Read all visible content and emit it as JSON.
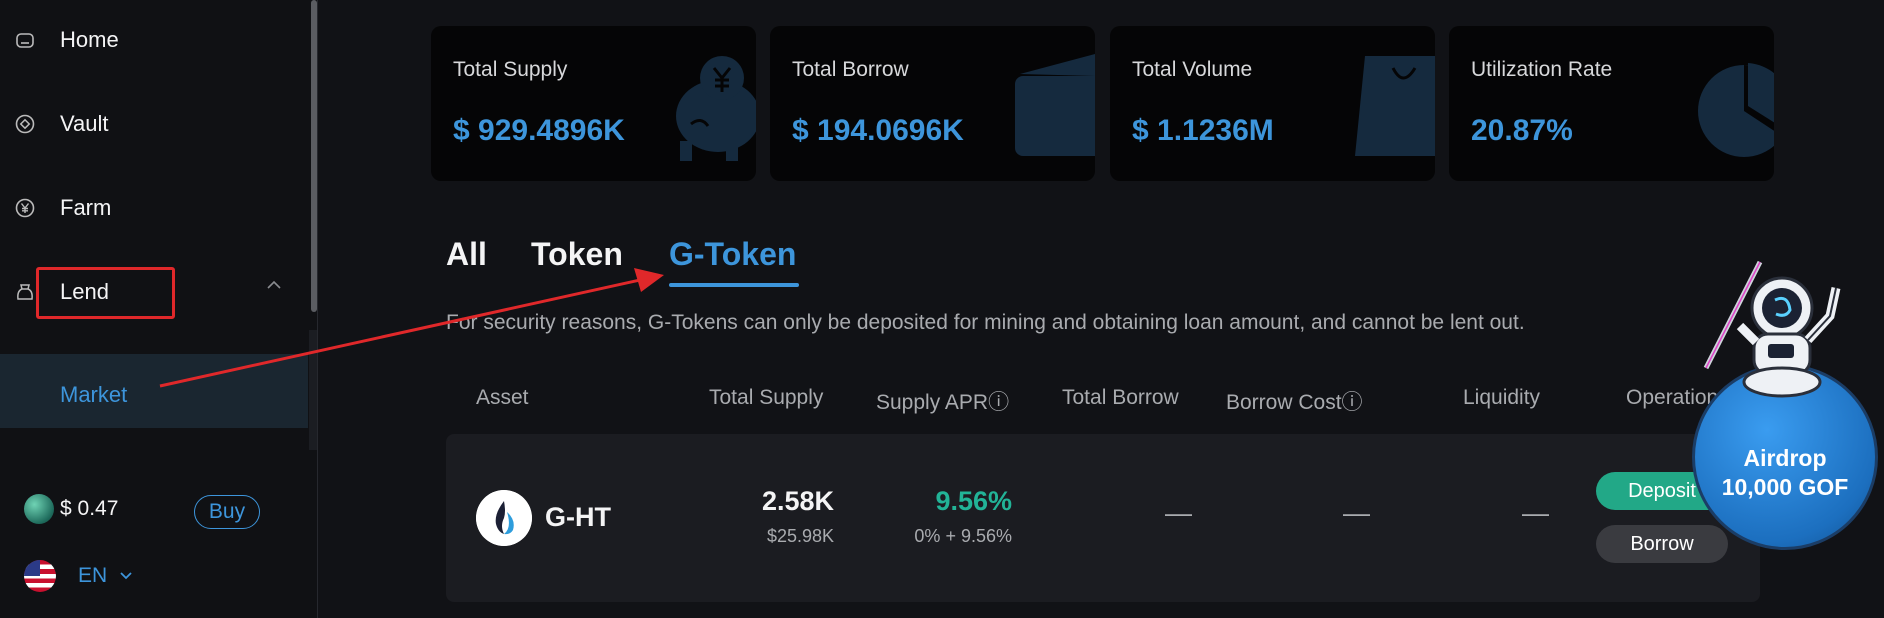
{
  "sidebar": {
    "items": [
      {
        "label": "Home",
        "icon": "home-icon"
      },
      {
        "label": "Vault",
        "icon": "vault-icon"
      },
      {
        "label": "Farm",
        "icon": "farm-icon"
      },
      {
        "label": "Lend",
        "icon": "lend-icon"
      }
    ],
    "submenu": [
      {
        "label": "Market"
      }
    ],
    "token_price": "$ 0.47",
    "buy_label": "Buy",
    "language": "EN"
  },
  "stats": [
    {
      "title": "Total Supply",
      "value": "$ 929.4896K",
      "icon": "piggy-bank-icon"
    },
    {
      "title": "Total Borrow",
      "value": "$ 194.0696K",
      "icon": "wallet-icon"
    },
    {
      "title": "Total Volume",
      "value": "$ 1.1236M",
      "icon": "shopping-bag-icon"
    },
    {
      "title": "Utilization Rate",
      "value": "20.87%",
      "icon": "pie-chart-icon"
    }
  ],
  "tabs": [
    {
      "label": "All",
      "active": false
    },
    {
      "label": "Token",
      "active": false
    },
    {
      "label": "G-Token",
      "active": true
    }
  ],
  "notice": "For security reasons, G-Tokens can only be deposited for mining and obtaining loan amount, and cannot be lent out.",
  "table": {
    "headers": [
      "Asset",
      "Total Supply",
      "Supply APRⓘ",
      "Total Borrow",
      "Borrow Costⓘ",
      "Liquidity",
      "Operation"
    ],
    "rows": [
      {
        "asset": "G-HT",
        "total_supply": "2.58K",
        "total_supply_usd": "$25.98K",
        "supply_apr": "9.56%",
        "supply_apr_detail": "0% + 9.56%",
        "total_borrow": "—",
        "borrow_cost": "—",
        "liquidity": "—",
        "deposit_label": "Deposit",
        "borrow_label": "Borrow"
      }
    ]
  },
  "airdrop": {
    "line1": "Airdrop",
    "line2": "10,000 GOF"
  },
  "colors": {
    "accent": "#3d95db",
    "green": "#22b397",
    "annotation": "#e0282a",
    "background": "#111216"
  }
}
